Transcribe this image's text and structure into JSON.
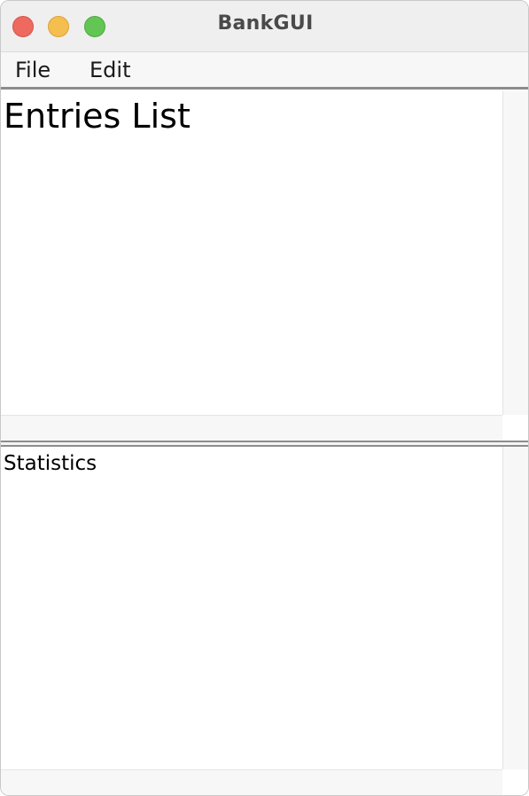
{
  "window": {
    "title": "BankGUI"
  },
  "menubar": {
    "items": [
      {
        "label": "File"
      },
      {
        "label": "Edit"
      }
    ]
  },
  "entries_pane": {
    "heading": "Entries List"
  },
  "statistics_pane": {
    "heading": "Statistics"
  },
  "colors": {
    "close": "#ee6a5f",
    "minimize": "#f5bf4f",
    "zoom": "#62c554",
    "titlebar": "#f0efef",
    "divider": "#8c8c8c"
  },
  "icons": {
    "close": "close-window-icon",
    "minimize": "minimize-window-icon",
    "zoom": "zoom-window-icon"
  }
}
